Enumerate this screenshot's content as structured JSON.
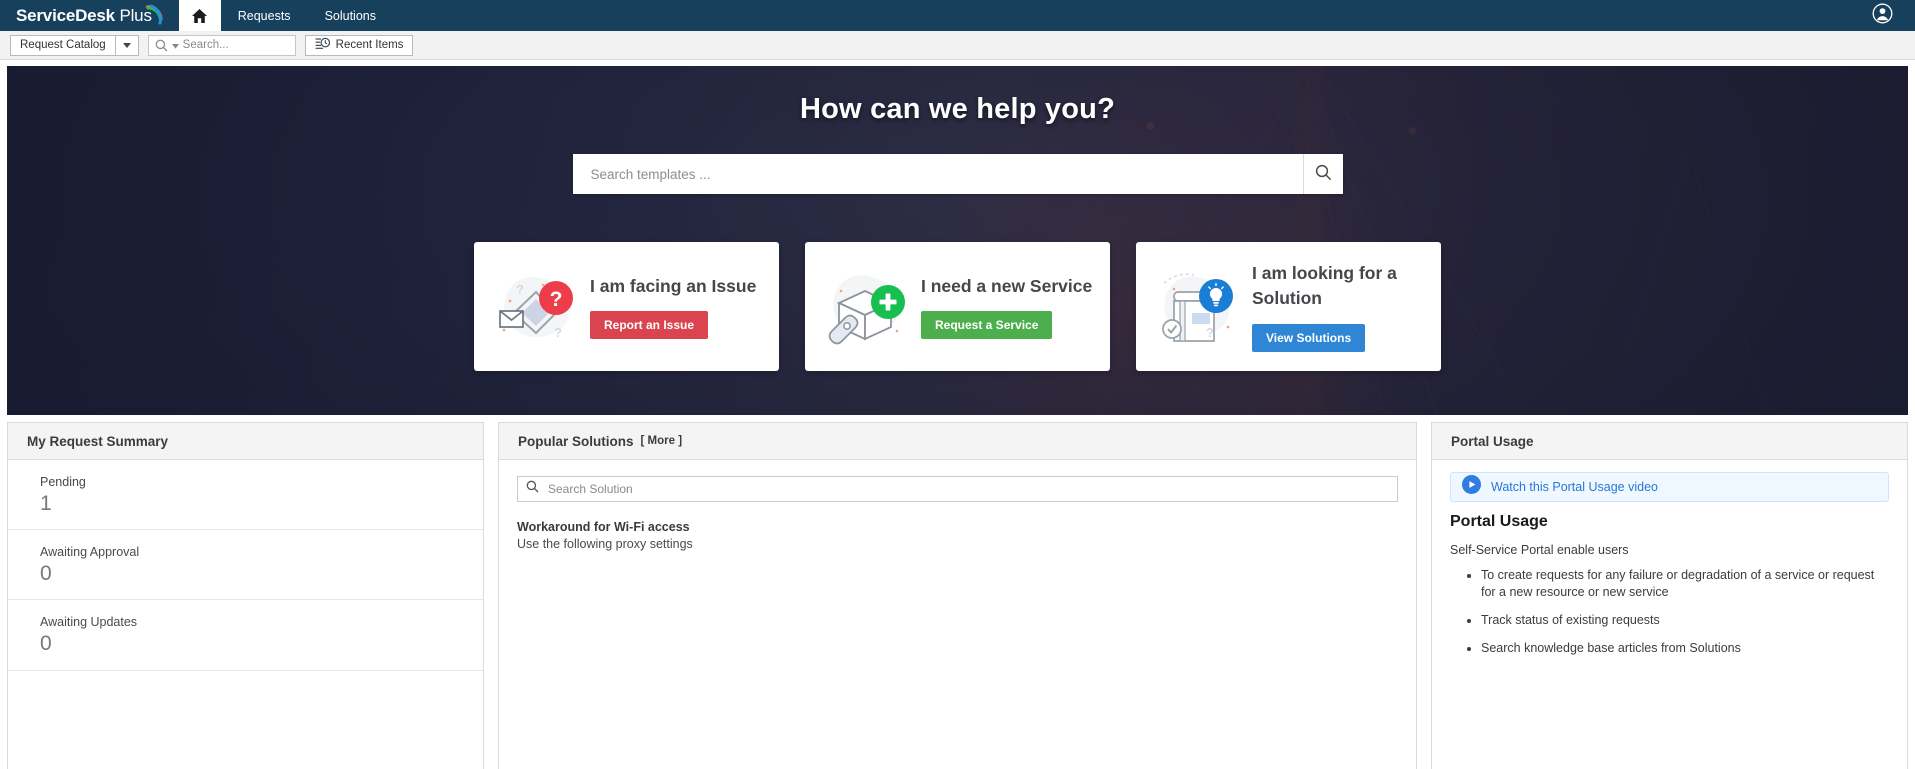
{
  "brand": {
    "bold": "ServiceDesk",
    "light": "Plus",
    "swoosh_icon": "logo-swoosh-icon"
  },
  "topnav": {
    "home_icon": "home-icon",
    "items": [
      {
        "label": "Requests",
        "name": "nav-item-requests"
      },
      {
        "label": "Solutions",
        "name": "nav-item-solutions"
      }
    ],
    "user_icon": "user-avatar-icon"
  },
  "subbar": {
    "catalog_label": "Request Catalog",
    "catalog_caret_icon": "chevron-down-icon",
    "search_icon": "search-icon",
    "search_placeholder": "Search...",
    "search_value": "",
    "recent_items_label": "Recent Items",
    "recent_items_icon": "recent-items-icon"
  },
  "hero": {
    "title": "How can we help you?",
    "search_placeholder": "Search templates ...",
    "search_value": "",
    "search_button_icon": "search-icon",
    "cards": [
      {
        "title": "I am facing an Issue",
        "button_label": "Report an Issue",
        "button_color": "#d9444f",
        "icon": "issue-envelope-question-icon",
        "badge_color": "#ed3d4a"
      },
      {
        "title": "I need a new Service",
        "button_label": "Request a Service",
        "button_color": "#4cae4c",
        "icon": "service-box-plus-icon",
        "badge_color": "#16bf4f"
      },
      {
        "title": "I am looking for a Solution",
        "button_label": "View Solutions",
        "button_color": "#2e86d4",
        "icon": "solution-book-bulb-icon",
        "badge_color": "#1a7fd4"
      }
    ]
  },
  "request_summary": {
    "title": "My Request Summary",
    "rows": [
      {
        "label": "Pending",
        "value": "1"
      },
      {
        "label": "Awaiting Approval",
        "value": "0"
      },
      {
        "label": "Awaiting Updates",
        "value": "0"
      }
    ]
  },
  "popular_solutions": {
    "title": "Popular Solutions",
    "more_label": "[ More ]",
    "search_placeholder": "Search Solution",
    "search_value": "",
    "search_icon": "search-icon",
    "items": [
      {
        "title": "Workaround for Wi-Fi access",
        "desc": "Use the following proxy settings"
      }
    ]
  },
  "portal_usage": {
    "title": "Portal Usage",
    "video_link_label": "Watch this Portal Usage video",
    "video_icon": "play-circle-icon",
    "heading": "Portal Usage",
    "intro": "Self-Service Portal enable users",
    "bullets": [
      "To create requests for any failure or degradation of a service or request for a new resource or new service",
      "Track status of existing requests",
      "Search knowledge base articles from Solutions"
    ]
  },
  "colors": {
    "navbar": "#17405c",
    "accent_blue": "#2e86d4",
    "accent_green": "#4cae4c",
    "accent_red": "#d9444f",
    "link_blue": "#2878d8"
  }
}
